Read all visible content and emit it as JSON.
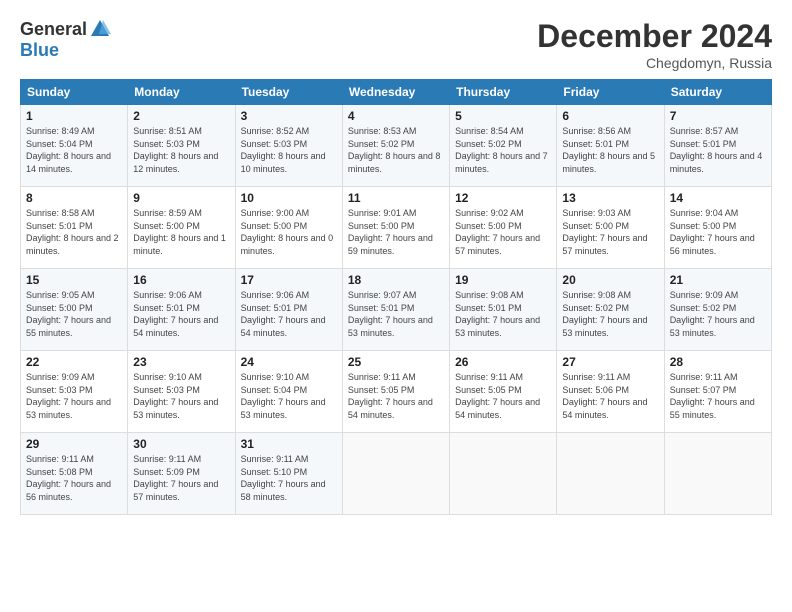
{
  "header": {
    "logo_general": "General",
    "logo_blue": "Blue",
    "title": "December 2024",
    "location": "Chegdomyn, Russia"
  },
  "columns": [
    "Sunday",
    "Monday",
    "Tuesday",
    "Wednesday",
    "Thursday",
    "Friday",
    "Saturday"
  ],
  "weeks": [
    [
      {
        "day": "1",
        "sunrise": "8:49 AM",
        "sunset": "5:04 PM",
        "daylight": "8 hours and 14 minutes."
      },
      {
        "day": "2",
        "sunrise": "8:51 AM",
        "sunset": "5:03 PM",
        "daylight": "8 hours and 12 minutes."
      },
      {
        "day": "3",
        "sunrise": "8:52 AM",
        "sunset": "5:03 PM",
        "daylight": "8 hours and 10 minutes."
      },
      {
        "day": "4",
        "sunrise": "8:53 AM",
        "sunset": "5:02 PM",
        "daylight": "8 hours and 8 minutes."
      },
      {
        "day": "5",
        "sunrise": "8:54 AM",
        "sunset": "5:02 PM",
        "daylight": "8 hours and 7 minutes."
      },
      {
        "day": "6",
        "sunrise": "8:56 AM",
        "sunset": "5:01 PM",
        "daylight": "8 hours and 5 minutes."
      },
      {
        "day": "7",
        "sunrise": "8:57 AM",
        "sunset": "5:01 PM",
        "daylight": "8 hours and 4 minutes."
      }
    ],
    [
      {
        "day": "8",
        "sunrise": "8:58 AM",
        "sunset": "5:01 PM",
        "daylight": "8 hours and 2 minutes."
      },
      {
        "day": "9",
        "sunrise": "8:59 AM",
        "sunset": "5:00 PM",
        "daylight": "8 hours and 1 minute."
      },
      {
        "day": "10",
        "sunrise": "9:00 AM",
        "sunset": "5:00 PM",
        "daylight": "8 hours and 0 minutes."
      },
      {
        "day": "11",
        "sunrise": "9:01 AM",
        "sunset": "5:00 PM",
        "daylight": "7 hours and 59 minutes."
      },
      {
        "day": "12",
        "sunrise": "9:02 AM",
        "sunset": "5:00 PM",
        "daylight": "7 hours and 57 minutes."
      },
      {
        "day": "13",
        "sunrise": "9:03 AM",
        "sunset": "5:00 PM",
        "daylight": "7 hours and 57 minutes."
      },
      {
        "day": "14",
        "sunrise": "9:04 AM",
        "sunset": "5:00 PM",
        "daylight": "7 hours and 56 minutes."
      }
    ],
    [
      {
        "day": "15",
        "sunrise": "9:05 AM",
        "sunset": "5:00 PM",
        "daylight": "7 hours and 55 minutes."
      },
      {
        "day": "16",
        "sunrise": "9:06 AM",
        "sunset": "5:01 PM",
        "daylight": "7 hours and 54 minutes."
      },
      {
        "day": "17",
        "sunrise": "9:06 AM",
        "sunset": "5:01 PM",
        "daylight": "7 hours and 54 minutes."
      },
      {
        "day": "18",
        "sunrise": "9:07 AM",
        "sunset": "5:01 PM",
        "daylight": "7 hours and 53 minutes."
      },
      {
        "day": "19",
        "sunrise": "9:08 AM",
        "sunset": "5:01 PM",
        "daylight": "7 hours and 53 minutes."
      },
      {
        "day": "20",
        "sunrise": "9:08 AM",
        "sunset": "5:02 PM",
        "daylight": "7 hours and 53 minutes."
      },
      {
        "day": "21",
        "sunrise": "9:09 AM",
        "sunset": "5:02 PM",
        "daylight": "7 hours and 53 minutes."
      }
    ],
    [
      {
        "day": "22",
        "sunrise": "9:09 AM",
        "sunset": "5:03 PM",
        "daylight": "7 hours and 53 minutes."
      },
      {
        "day": "23",
        "sunrise": "9:10 AM",
        "sunset": "5:03 PM",
        "daylight": "7 hours and 53 minutes."
      },
      {
        "day": "24",
        "sunrise": "9:10 AM",
        "sunset": "5:04 PM",
        "daylight": "7 hours and 53 minutes."
      },
      {
        "day": "25",
        "sunrise": "9:11 AM",
        "sunset": "5:05 PM",
        "daylight": "7 hours and 54 minutes."
      },
      {
        "day": "26",
        "sunrise": "9:11 AM",
        "sunset": "5:05 PM",
        "daylight": "7 hours and 54 minutes."
      },
      {
        "day": "27",
        "sunrise": "9:11 AM",
        "sunset": "5:06 PM",
        "daylight": "7 hours and 54 minutes."
      },
      {
        "day": "28",
        "sunrise": "9:11 AM",
        "sunset": "5:07 PM",
        "daylight": "7 hours and 55 minutes."
      }
    ],
    [
      {
        "day": "29",
        "sunrise": "9:11 AM",
        "sunset": "5:08 PM",
        "daylight": "7 hours and 56 minutes."
      },
      {
        "day": "30",
        "sunrise": "9:11 AM",
        "sunset": "5:09 PM",
        "daylight": "7 hours and 57 minutes."
      },
      {
        "day": "31",
        "sunrise": "9:11 AM",
        "sunset": "5:10 PM",
        "daylight": "7 hours and 58 minutes."
      },
      null,
      null,
      null,
      null
    ]
  ]
}
